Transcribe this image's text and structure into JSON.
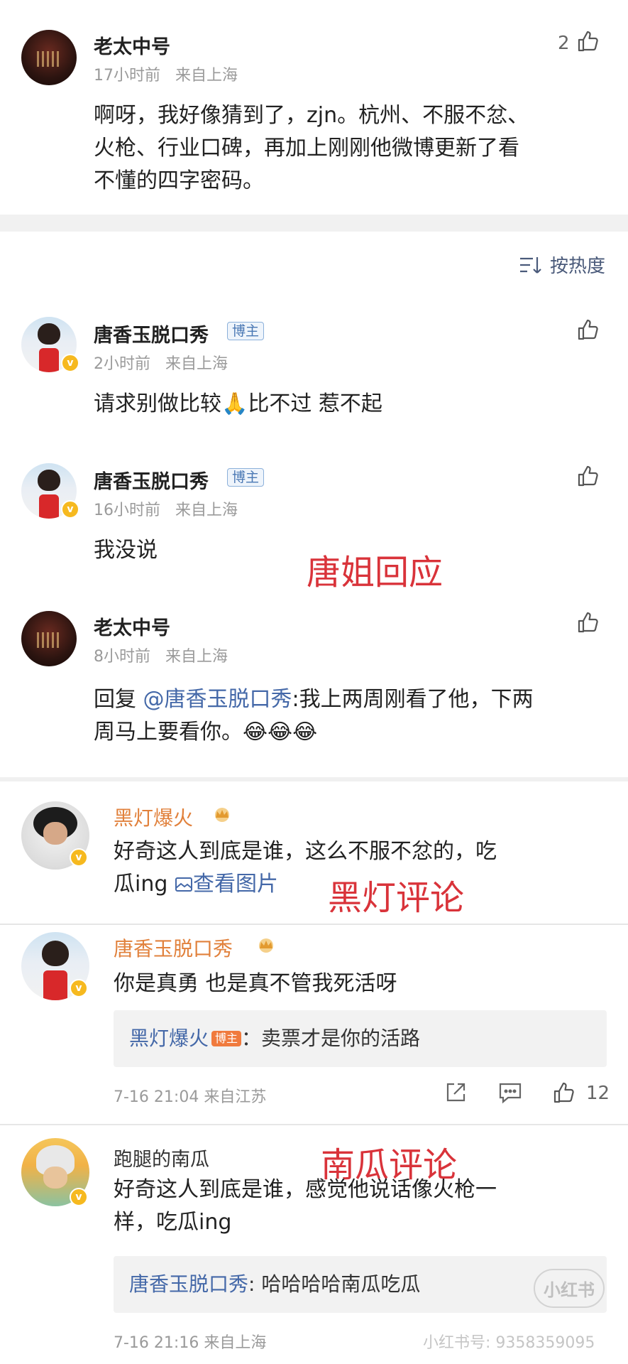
{
  "comment1": {
    "username": "老太中号",
    "time": "17小时前",
    "location": "来自上海",
    "like_count": "2",
    "text_line1": "啊呀，我好像猜到了，zjn。杭州、不服不忿、",
    "text_line2": "火枪、行业口碑，再加上刚刚他微博更新了看",
    "text_line3": "不懂的四字密码。"
  },
  "sort": {
    "icon": "sort-icon",
    "label": "按热度"
  },
  "comment2": {
    "username": "唐香玉脱口秀",
    "badge": "博主",
    "time": "2小时前",
    "location": "来自上海",
    "text_before": "请求别做比较",
    "emoji": "🙏",
    "text_after": "比不过 惹不起"
  },
  "comment3": {
    "username": "唐香玉脱口秀",
    "badge": "博主",
    "time": "16小时前",
    "location": "来自上海",
    "text": "我没说"
  },
  "overlay1": "唐姐回应",
  "comment4": {
    "username": "老太中号",
    "time": "8小时前",
    "location": "来自上海",
    "reply_prefix": "回复 ",
    "reply_target": "@唐香玉脱口秀",
    "text_line1_rest": ":我上两周刚看了他，下两",
    "text_line2": "周马上要看你。",
    "emoji": "😂😂😂"
  },
  "comment5": {
    "username": "黑灯爆火",
    "text_line1": "好奇这人到底是谁，这么不服不忿的，吃",
    "text_line2": "瓜ing",
    "view_image_icon": "image-icon",
    "view_image_label": "查看图片"
  },
  "overlay2": "黑灯评论",
  "comment6": {
    "username": "唐香玉脱口秀",
    "text": "你是真勇 也是真不管我死活呀",
    "quote_name": "黑灯爆火",
    "quote_badge": "博主",
    "quote_text": "：卖票才是你的活路",
    "time": "7-16 21:04 来自江苏",
    "like_count": "12"
  },
  "comment7": {
    "username": "跑腿的南瓜",
    "text_line1": "好奇这人到底是谁，感觉他说话像火枪一",
    "text_line2": "样，吃瓜ing",
    "quote_name": "唐香玉脱口秀",
    "quote_text": ": 哈哈哈哈南瓜吃瓜",
    "time": "7-16 21:16 来自上海"
  },
  "overlay3": "南瓜评论",
  "watermark": {
    "logo": "小红书",
    "text": "小红书号: 9358359095"
  },
  "colors": {
    "overlay_red": "#d9333a",
    "link_blue": "#4468a8",
    "name_orange": "#e1813c",
    "vip_yellow": "#f6b91f"
  }
}
